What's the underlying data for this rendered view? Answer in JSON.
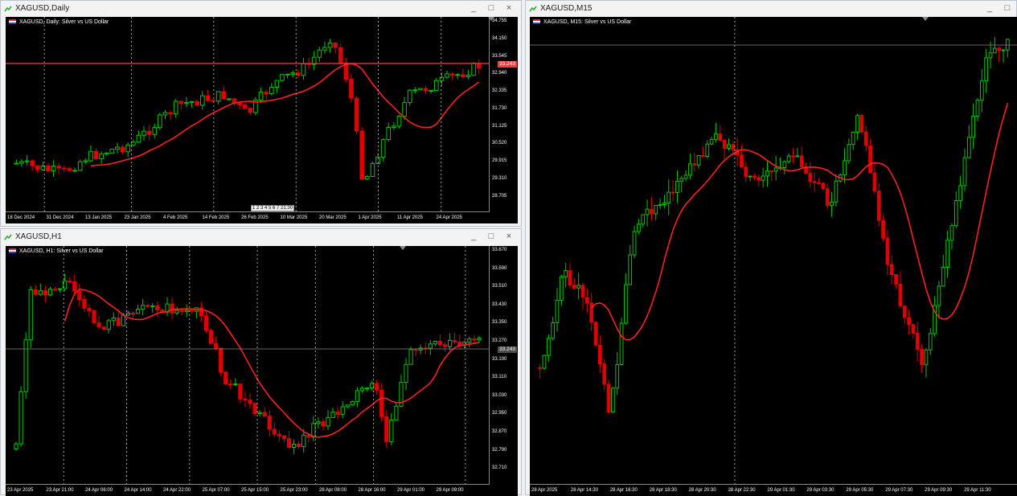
{
  "windows": {
    "daily": {
      "title": "XAGUSD,Daily",
      "label": "XAGUSD, Daily:  Silver vs US Dollar",
      "yticks": [
        "34.755",
        "34.150",
        "33.545",
        "32.940",
        "32.335",
        "31.730",
        "31.125",
        "30.520",
        "29.915",
        "29.310",
        "28.705"
      ],
      "xticks": [
        "18 Dec 2024",
        "31 Dec 2024",
        "13 Jan 2025",
        "23 Jan 2025",
        "4 Feb 2025",
        "14 Feb 2025",
        "26 Feb 2025",
        "10 Mar 2025",
        "20 Mar 2025",
        "1 Apr 2025",
        "11 Apr 2025",
        "24 Apr 2025"
      ],
      "price": "33.243",
      "scroll_nav": "1 2 3 4 5 6 7 21:30"
    },
    "h1": {
      "title": "XAGUSD,H1",
      "label": "XAGUSD, H1:  Silver vs US Dollar",
      "yticks": [
        "33.670",
        "33.590",
        "33.510",
        "33.430",
        "33.350",
        "33.270",
        "33.190",
        "33.110",
        "33.030",
        "32.950",
        "32.870",
        "32.790",
        "32.710"
      ],
      "xticks": [
        "23 Apr 2025",
        "23 Apr 21:00",
        "24 Apr 06:00",
        "24 Apr 14:00",
        "24 Apr 22:00",
        "25 Apr 07:00",
        "25 Apr 15:00",
        "25 Apr 23:00",
        "28 Apr 08:00",
        "28 Apr 16:00",
        "29 Apr 01:00",
        "29 Apr 09:00"
      ],
      "price": "33.243"
    },
    "m15": {
      "title": "XAGUSD,M15",
      "label": "XAGUSD, M15:  Silver vs US Dollar",
      "xticks": [
        "28 Apr 2025",
        "28 Apr 14:30",
        "28 Apr 16:30",
        "28 Apr 18:30",
        "28 Apr 20:30",
        "28 Apr 22:30",
        "29 Apr 01:30",
        "29 Apr 03:30",
        "29 Apr 05:30",
        "29 Apr 07:30",
        "29 Apr 09:30",
        "29 Apr 11:30"
      ]
    }
  },
  "window_buttons": {
    "minimize": "_",
    "maximize": "□",
    "close": "×"
  },
  "colors": {
    "bull": "#00c800",
    "bear": "#e00000",
    "ma": "#ff2020",
    "grid": "#c8c8c8",
    "bg": "#000000",
    "price_line": "#ff3b3b"
  }
}
